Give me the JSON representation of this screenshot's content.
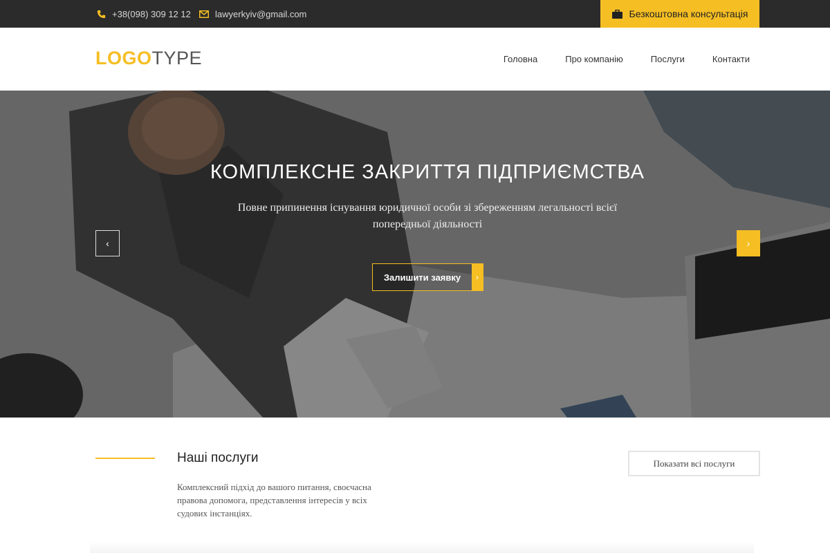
{
  "topbar": {
    "phone": "+38(098) 309 12 12",
    "email": "lawyerkyiv@gmail.com",
    "consult_label": "Безкоштовна консультація",
    "accent": "#f5be23",
    "background": "#2b2b2b"
  },
  "header": {
    "logo_a": "LOGO",
    "logo_b": "TYPE",
    "nav": [
      {
        "label": "Головна"
      },
      {
        "label": "Про компанію"
      },
      {
        "label": "Послуги"
      },
      {
        "label": "Контакти"
      }
    ]
  },
  "hero": {
    "title": "КОМПЛЕКСНЕ ЗАКРИТТЯ ПІДПРИЄМСТВА",
    "subtitle": "Повне припинення існування юридичної особи зі збереженням легальності всієї попередньої діяльності",
    "cta_label": "Залишити заявку",
    "prev_icon": "‹",
    "next_icon": "›",
    "cta_icon": "›"
  },
  "services": {
    "title": "Наші послуги",
    "description": "Комплексний підхід до вашого питання, своєчасна правова допомога, представлення інтересів у всіх судових інстанціях.",
    "show_all_label": "Показати всі послуги"
  }
}
